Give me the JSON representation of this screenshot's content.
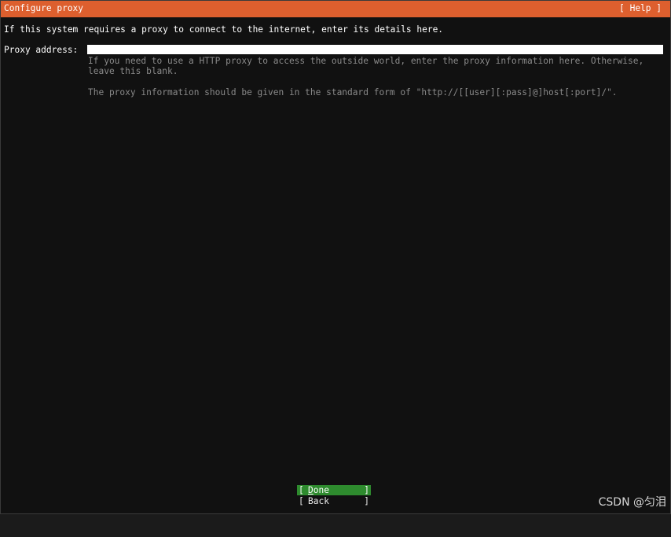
{
  "header": {
    "title": "Configure proxy",
    "help_label": "[ Help ]"
  },
  "main": {
    "intro": "If this system requires a proxy to connect to the internet, enter its details here.",
    "proxy_field": {
      "label": "Proxy address:",
      "value": "",
      "help_line_1": "If you need to use a HTTP proxy to access the outside world, enter the proxy information here. Otherwise,",
      "help_line_2": "leave this blank.",
      "help_line_3": "The proxy information should be given in the standard form of \"http://[[user][:pass]@]host[:port]/\"."
    }
  },
  "buttons": {
    "open_bracket": "[",
    "close_bracket": "]",
    "done_label": "Done",
    "back_label": "Back"
  },
  "watermark": "CSDN @匀泪",
  "colors": {
    "titlebar": "#dd5f2e",
    "background": "#111111",
    "done_highlight": "#2e8b2e",
    "help_text": "#8a8a8a"
  }
}
